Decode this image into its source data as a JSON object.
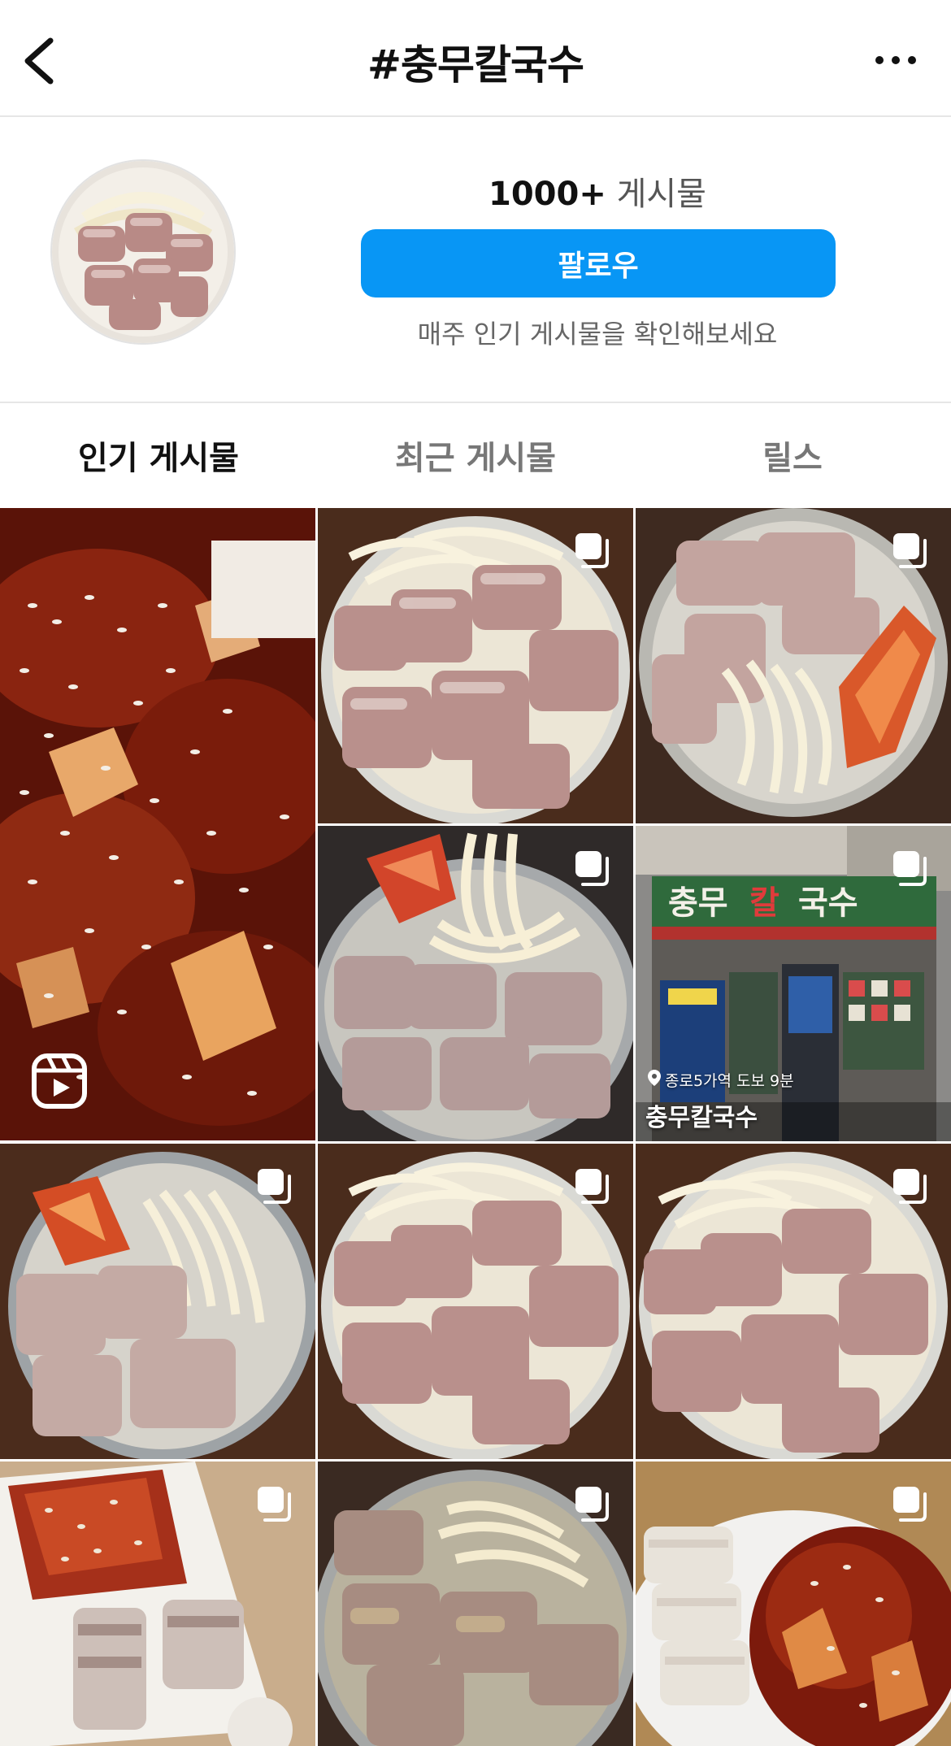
{
  "header": {
    "title": "#충무칼국수",
    "back_icon": "chevron-left-icon",
    "more_icon": "more-horizontal-icon"
  },
  "profile": {
    "post_count": "1000+",
    "post_count_label": " 게시물",
    "follow_label": "팔로우",
    "subtitle": "매주 인기 게시물을 확인해보세요",
    "accent_color": "#0896f5"
  },
  "tabs": [
    {
      "label": "인기 게시물",
      "active": true
    },
    {
      "label": "최근 게시물",
      "active": false
    },
    {
      "label": "릴스",
      "active": false
    }
  ],
  "grid": {
    "posts": [
      {
        "kind": "reel",
        "subject": "spicy braised dish with sesame"
      },
      {
        "kind": "carousel",
        "subject": "noodles with boiled pork"
      },
      {
        "kind": "carousel",
        "subject": "noodles with pork and kimchi"
      },
      {
        "kind": "carousel",
        "subject": "noodles lifted with kimchi"
      },
      {
        "kind": "carousel",
        "subject": "restaurant storefront",
        "location": "종로5가역 도보 9분",
        "place_name": "충무칼국수",
        "sign_text": "충무칼국수"
      },
      {
        "kind": "carousel",
        "subject": "noodles with pork and kimchi"
      },
      {
        "kind": "carousel",
        "subject": "noodles with boiled pork"
      },
      {
        "kind": "carousel",
        "subject": "noodles with boiled pork"
      },
      {
        "kind": "carousel",
        "subject": "kimchi and boiled pork plate"
      },
      {
        "kind": "carousel",
        "subject": "noodle soup with beef"
      },
      {
        "kind": "carousel",
        "subject": "pork with spicy braised dish"
      }
    ]
  }
}
